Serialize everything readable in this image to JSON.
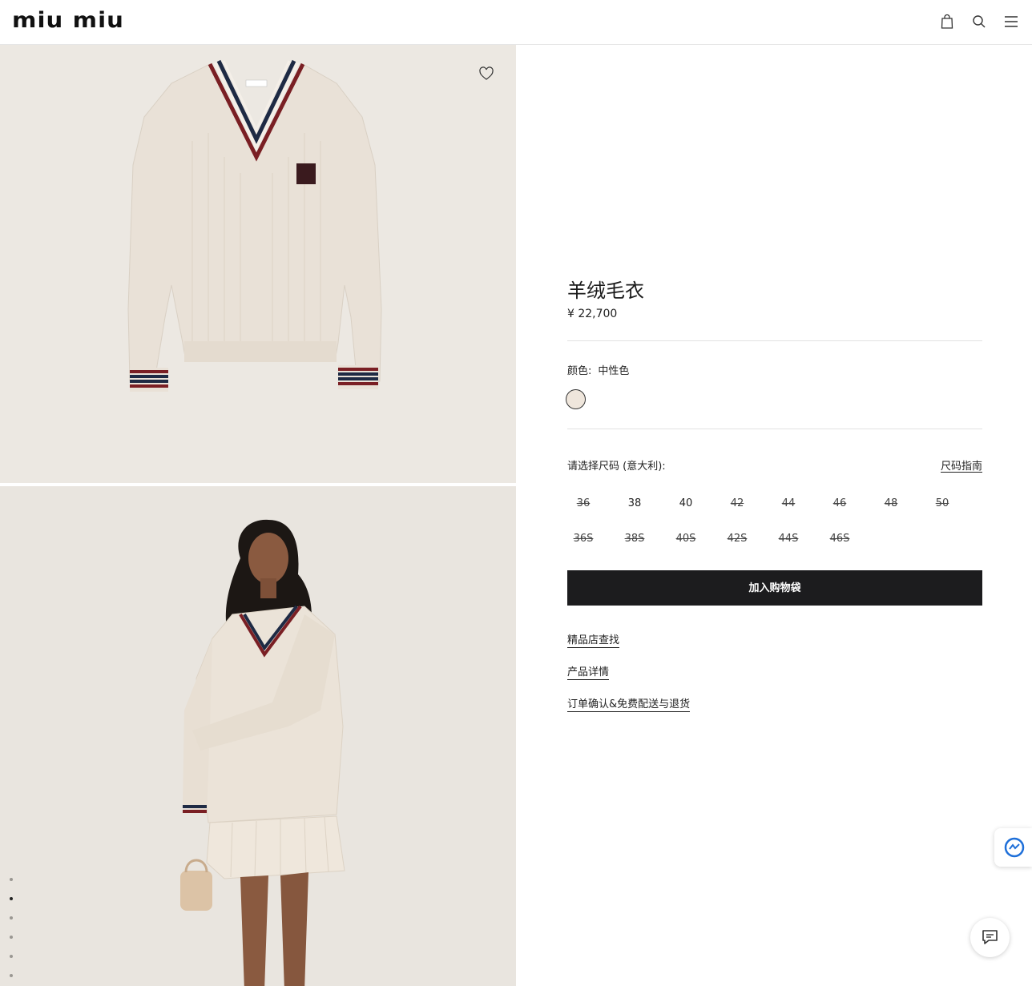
{
  "header": {
    "logo": "miu miu",
    "icons": [
      "shopping-bag-icon",
      "search-icon",
      "menu-icon"
    ]
  },
  "gallery": {
    "images": [
      {
        "name": "product-image-flat"
      },
      {
        "name": "product-image-model"
      }
    ],
    "dots_count": 6,
    "active_dot": 1
  },
  "product": {
    "title": "羊绒毛衣",
    "price": "¥ 22,700"
  },
  "color": {
    "label": "颜色:",
    "value": "中性色",
    "swatch_color": "#efe6dc"
  },
  "size": {
    "label": "请选择尺码 (意大利):",
    "guide": "尺码指南",
    "row1": [
      {
        "label": "36",
        "available": false
      },
      {
        "label": "38",
        "available": true
      },
      {
        "label": "40",
        "available": true
      },
      {
        "label": "42",
        "available": false
      },
      {
        "label": "44",
        "available": false
      },
      {
        "label": "46",
        "available": false
      },
      {
        "label": "48",
        "available": false
      },
      {
        "label": "50",
        "available": false
      }
    ],
    "row2": [
      {
        "label": "36S",
        "available": false
      },
      {
        "label": "38S",
        "available": false
      },
      {
        "label": "40S",
        "available": false
      },
      {
        "label": "42S",
        "available": false
      },
      {
        "label": "44S",
        "available": false
      },
      {
        "label": "46S",
        "available": false
      }
    ]
  },
  "cta": {
    "add_to_bag": "加入购物袋"
  },
  "links": {
    "boutique": "精品店查找",
    "details": "产品详情",
    "shipping": "订单确认&免费配送与退货"
  },
  "colors": {
    "button_bg": "#1c1c1e",
    "image_bg": "#ece8e2"
  }
}
